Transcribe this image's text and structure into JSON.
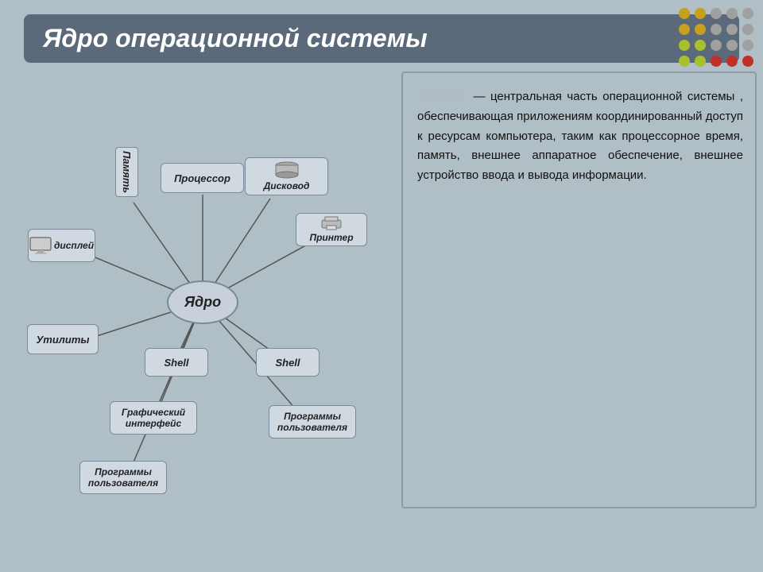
{
  "title": "Ядро операционной системы",
  "dots": {
    "colors": [
      "#c8a020",
      "#c8a020",
      "#a0a0a0",
      "#a0a0a0",
      "#a0a0a0",
      "#c8a020",
      "#c8a020",
      "#a0a0a0",
      "#a0a0a0",
      "#a0a0a0",
      "#a8c030",
      "#a8c030",
      "#a0a0a0",
      "#a0a0a0",
      "#a0a0a0",
      "#a8c030",
      "#a8c030",
      "#c0302a",
      "#c0302a",
      "#c0302a"
    ]
  },
  "nodes": {
    "yadro": "Ядро",
    "display": "дисплей",
    "memory": "П\nа\nм\nя\nт\nь",
    "processor": "Процессор",
    "disk": "Дисковод",
    "printer": "Принтер",
    "utilities": "Утилиты",
    "shell1": "Shell",
    "shell2": "Shell",
    "graphicUI": "Графический\nинтерфейс",
    "userPrograms1": "Программы\nпользователя",
    "userPrograms2": "Программы\nпользователя"
  },
  "description": "— центральная часть операционной системы , обеспечивающая приложениям координированный доступ к ресурсам компьютера, таким как процессорное время, память, внешнее аппаратное обеспечение, внешнее устройство ввода и вывода информации."
}
